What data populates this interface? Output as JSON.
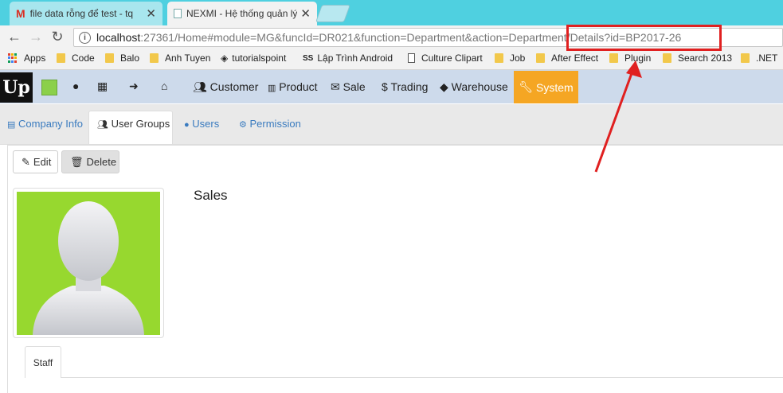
{
  "browser": {
    "tabs": [
      {
        "title": "file data rỗng để test - tq",
        "icon": "gmail-icon"
      },
      {
        "title": "NEXMI - Hệ thống quản lý",
        "icon": "page-icon"
      }
    ],
    "url_host": "localhost",
    "url_rest": ":27361/Home#module=MG&funcId=DR021&function=Department&action=Department/Details?id=BP2017-26",
    "bookmarks": [
      {
        "label": "Apps",
        "icon": "apps-grid-icon"
      },
      {
        "label": "Code",
        "icon": "folder-icon"
      },
      {
        "label": "Balo",
        "icon": "folder-icon"
      },
      {
        "label": "Anh Tuyen",
        "icon": "folder-icon"
      },
      {
        "label": "tutorialspoint",
        "icon": "diamond-icon"
      },
      {
        "label": "Lập Trình Android",
        "icon": "bookmark-icon"
      },
      {
        "label": "Culture Clipart",
        "icon": "page-icon"
      },
      {
        "label": "Job",
        "icon": "folder-icon"
      },
      {
        "label": "After Effect",
        "icon": "folder-icon"
      },
      {
        "label": "Plugin",
        "icon": "folder-icon"
      },
      {
        "label": "Search 2013",
        "icon": "folder-icon"
      },
      {
        "label": ".NET",
        "icon": "folder-icon"
      }
    ]
  },
  "app": {
    "logo": "Up",
    "nav": [
      {
        "label": "Customer",
        "icon": "users-icon"
      },
      {
        "label": "Product",
        "icon": "barcode-icon"
      },
      {
        "label": "Sale",
        "icon": "envelope-icon"
      },
      {
        "label": "Trading",
        "icon": "dollar-icon"
      },
      {
        "label": "Warehouse",
        "icon": "tags-icon"
      },
      {
        "label": "System",
        "icon": "wrench-icon"
      }
    ],
    "subtabs": [
      {
        "label": "Company Info",
        "icon": "building-icon"
      },
      {
        "label": "User Groups",
        "icon": "users-icon"
      },
      {
        "label": "Users",
        "icon": "user-icon"
      },
      {
        "label": "Permission",
        "icon": "cogs-icon"
      }
    ],
    "actions": {
      "edit": "Edit",
      "delete": "Delete"
    },
    "group_name": "Sales",
    "detail_tabs": [
      "Staff"
    ]
  },
  "colors": {
    "tabstrip": "#4fd0e0",
    "nav_bg": "#cddaeb",
    "system_active": "#f5a623",
    "photo_bg": "#97d82f",
    "annotation": "#e02020",
    "link": "#3a7bbf"
  }
}
